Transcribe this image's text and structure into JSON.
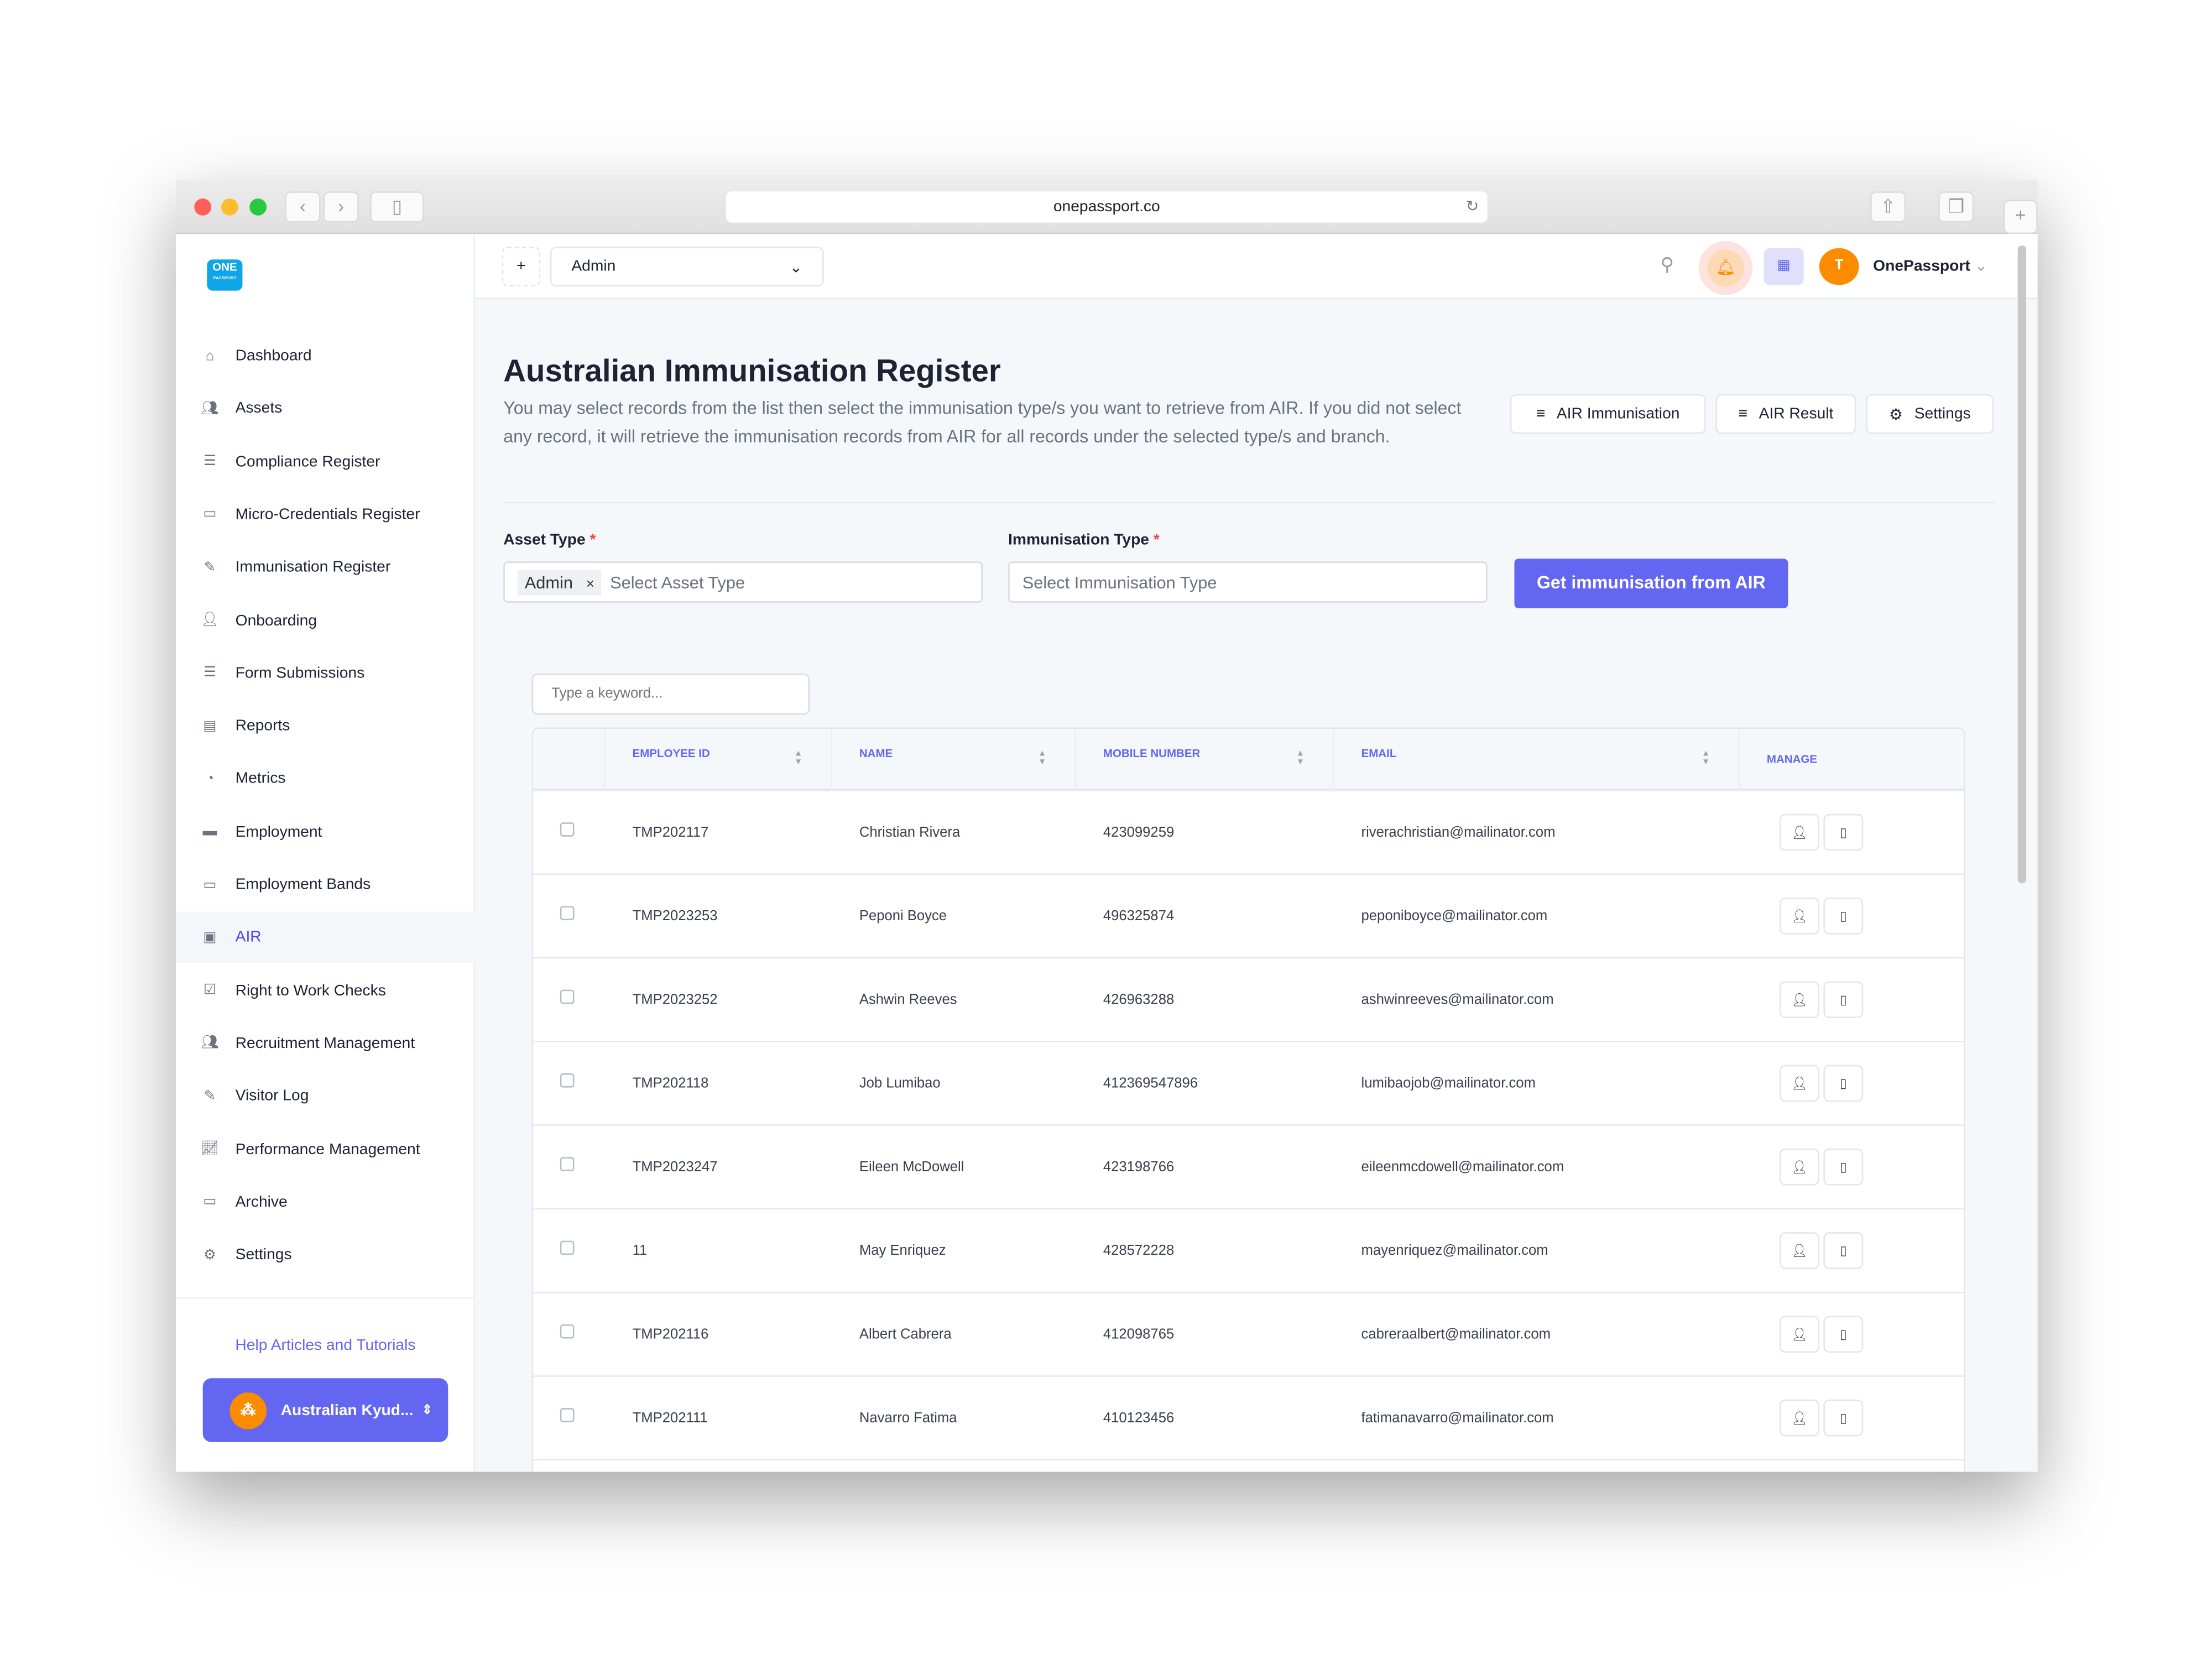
{
  "browser": {
    "url": "onepassport.co"
  },
  "logo": {
    "line1": "ONE",
    "line2": "PASSPORT"
  },
  "sidebar": {
    "items": [
      {
        "label": "Dashboard",
        "icon": "home-icon"
      },
      {
        "label": "Assets",
        "icon": "users-icon"
      },
      {
        "label": "Compliance Register",
        "icon": "list-icon"
      },
      {
        "label": "Micro-Credentials Register",
        "icon": "id-card-icon"
      },
      {
        "label": "Immunisation Register",
        "icon": "bandage-icon"
      },
      {
        "label": "Onboarding",
        "icon": "user-plus-icon"
      },
      {
        "label": "Form Submissions",
        "icon": "list-icon"
      },
      {
        "label": "Reports",
        "icon": "report-icon"
      },
      {
        "label": "Metrics",
        "icon": "pie-chart-icon"
      },
      {
        "label": "Employment",
        "icon": "briefcase-icon"
      },
      {
        "label": "Employment Bands",
        "icon": "briefcase-outline-icon"
      },
      {
        "label": "AIR",
        "icon": "air-icon",
        "active": true
      },
      {
        "label": "Right to Work Checks",
        "icon": "clipboard-check-icon"
      },
      {
        "label": "Recruitment Management",
        "icon": "users-icon"
      },
      {
        "label": "Visitor Log",
        "icon": "pen-icon"
      },
      {
        "label": "Performance Management",
        "icon": "chart-line-icon"
      },
      {
        "label": "Archive",
        "icon": "archive-icon"
      },
      {
        "label": "Settings",
        "icon": "gear-icon"
      }
    ],
    "help": "Help Articles and Tutorials",
    "org": "Australian Kyud..."
  },
  "topbar": {
    "selector": "Admin",
    "user_initial": "T",
    "user_name": "OnePassport"
  },
  "page": {
    "title": "Australian Immunisation Register",
    "description": "You may select records from the list then select the immunisation type/s you want to retrieve from AIR. If you did not select any record, it will retrieve the immunisation records from AIR for all records under the selected type/s and branch.",
    "buttons": {
      "air_immunisation": "AIR Immunisation",
      "air_result": "AIR Result",
      "settings": "Settings"
    },
    "asset_type_label": "Asset Type",
    "asset_type_chip": "Admin",
    "asset_type_placeholder": "Select Asset Type",
    "immunisation_type_label": "Immunisation Type",
    "immunisation_type_placeholder": "Select Immunisation Type",
    "required": "*",
    "get_button": "Get immunisation from AIR",
    "search_placeholder": "Type a keyword..."
  },
  "table": {
    "columns": [
      "EMPLOYEE ID",
      "NAME",
      "MOBILE NUMBER",
      "EMAIL",
      "MANAGE"
    ],
    "rows": [
      [
        "TMP202117",
        "Christian Rivera",
        "423099259",
        "riverachristian@mailinator.com"
      ],
      [
        "TMP2023253",
        "Peponi Boyce",
        "496325874",
        "peponiboyce@mailinator.com"
      ],
      [
        "TMP2023252",
        "Ashwin Reeves",
        "426963288",
        "ashwinreeves@mailinator.com"
      ],
      [
        "TMP202118",
        "Job Lumibao",
        "412369547896",
        "lumibaojob@mailinator.com"
      ],
      [
        "TMP2023247",
        "Eileen McDowell",
        "423198766",
        "eileenmcdowell@mailinator.com"
      ],
      [
        "11",
        "May Enriquez",
        "428572228",
        "mayenriquez@mailinator.com"
      ],
      [
        "TMP202116",
        "Albert Cabrera",
        "412098765",
        "cabreraalbert@mailinator.com"
      ],
      [
        "TMP202111",
        "Navarro Fatima",
        "410123456",
        "fatimanavarro@mailinator.com"
      ]
    ]
  },
  "colors": {
    "accent": "#6366f1",
    "orange": "#fb8c00",
    "logo": "#0ea5e9"
  }
}
